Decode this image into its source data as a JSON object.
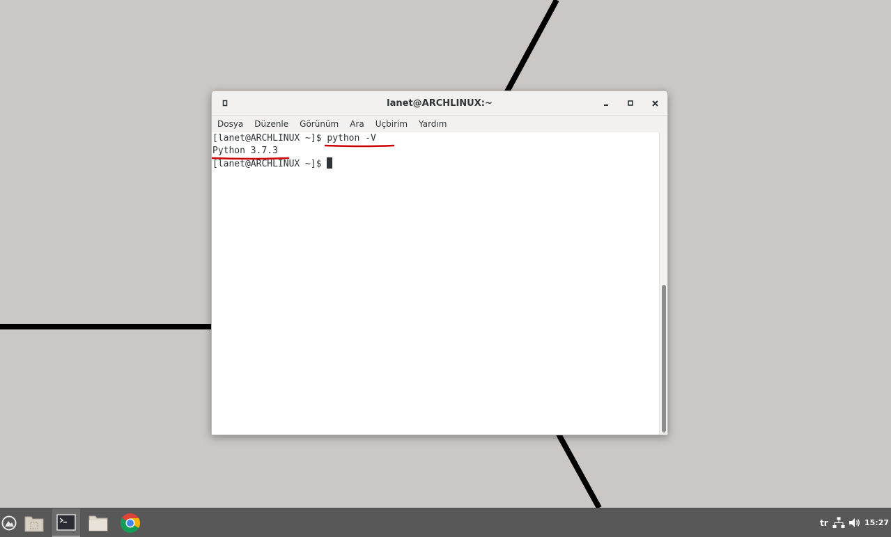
{
  "window": {
    "title": "lanet@ARCHLINUX:~",
    "menu_icon": "terminal-menu-icon",
    "minimize_label": "_",
    "maximize_label": "□",
    "close_label": "×"
  },
  "menubar": {
    "items": [
      "Dosya",
      "Düzenle",
      "Görünüm",
      "Ara",
      "Uçbirim",
      "Yardım"
    ]
  },
  "terminal": {
    "prompt": "[lanet@ARCHLINUX ~]$ ",
    "command": "python -V",
    "output": "Python 3.7.3",
    "prompt2": "[lanet@ARCHLINUX ~]$ "
  },
  "annotations": {
    "underline_color": "#cc0000"
  },
  "taskbar": {
    "apps": [
      "start-menu-icon",
      "file-manager-icon",
      "terminal-icon",
      "folder-icon",
      "chrome-icon"
    ],
    "keyboard_layout": "tr",
    "network_icon": "network-icon",
    "volume_icon": "volume-icon",
    "clock": "15:27"
  },
  "colors": {
    "desktop_bg": "#cbc7c5",
    "wallpaper_lines": "#000000",
    "taskbar_bg": "#585858",
    "terminal_fg": "#2e3436"
  }
}
